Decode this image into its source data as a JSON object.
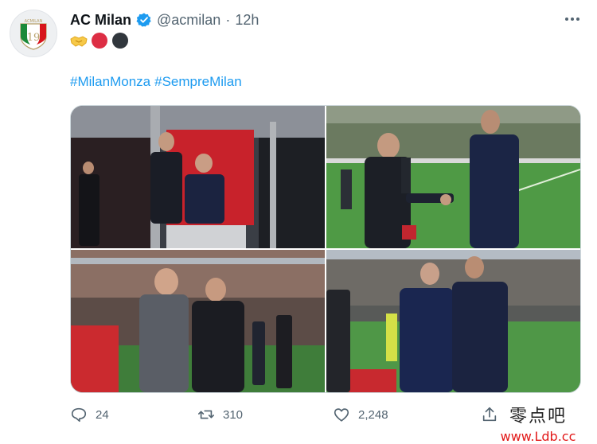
{
  "tweet": {
    "display_name": "AC Milan",
    "handle": "@acmilan",
    "separator": "·",
    "time": "12h",
    "avatar_label": "ACMILAN",
    "avatar_number": "19",
    "emojis": [
      "handshake-emoji",
      "red-circle-emoji",
      "black-circle-emoji"
    ],
    "hashtags": [
      "#MilanMonza",
      "#SempreMilan"
    ],
    "media_count": 4
  },
  "actions": {
    "reply_count": "24",
    "retweet_count": "310",
    "like_count": "2,248"
  },
  "watermark": {
    "chinese_text": "零点吧",
    "url": "www.Ldb.cc"
  },
  "colors": {
    "accent": "#1d9bf0",
    "milan_red": "#d7141a",
    "text_secondary": "#536471"
  }
}
